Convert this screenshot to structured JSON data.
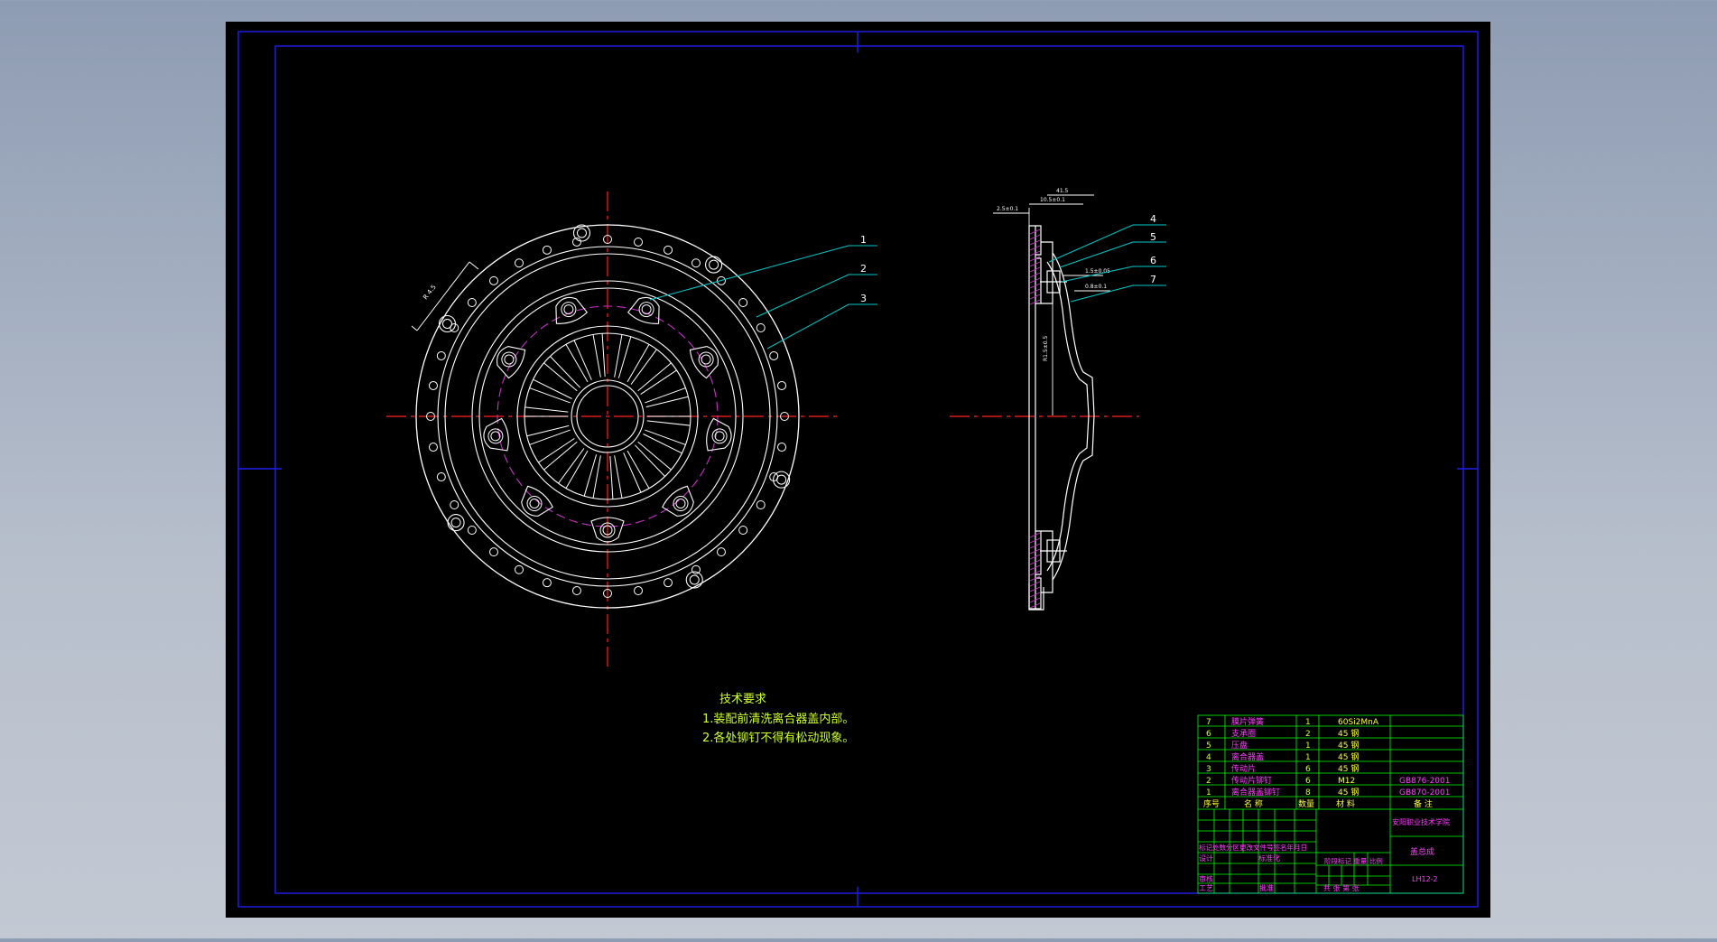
{
  "colors": {
    "background": "#000000",
    "frame": "#1e1ef0",
    "geometry": "#ffffff",
    "leader": "#00c8c8",
    "centerline": "#ff2020",
    "hidden": "#c832c8",
    "table_line": "#00ff00",
    "text_green": "#d0ff30",
    "text_magenta": "#ff40ff",
    "text_yellow": "#ffff40"
  },
  "balloons": [
    "1",
    "2",
    "3",
    "4",
    "5",
    "6",
    "7"
  ],
  "notes": {
    "title": "技术要求",
    "items": [
      "1.装配前清洗离合器盖内部。",
      "2.各处铆钉不得有松动现象。"
    ]
  },
  "bom": {
    "rows": [
      {
        "no": "7",
        "name": "膜片弹簧",
        "qty": "1",
        "material": "60Si2MnA",
        "remark": ""
      },
      {
        "no": "6",
        "name": "支承圈",
        "qty": "2",
        "material": "45 钢",
        "remark": ""
      },
      {
        "no": "5",
        "name": "压盘",
        "qty": "1",
        "material": "45 钢",
        "remark": ""
      },
      {
        "no": "4",
        "name": "离合器盖",
        "qty": "1",
        "material": "45 钢",
        "remark": ""
      },
      {
        "no": "3",
        "name": "传动片",
        "qty": "6",
        "material": "45 钢",
        "remark": ""
      },
      {
        "no": "2",
        "name": "传动片铆钉",
        "qty": "6",
        "material": "M12",
        "remark": "GB876-2001"
      },
      {
        "no": "1",
        "name": "离合器盖铆钉",
        "qty": "8",
        "material": "45 钢",
        "remark": "GB870-2001"
      }
    ],
    "header": {
      "no": "序号",
      "name": "名 称",
      "qty": "数量",
      "material": "材 料",
      "remark": "备 注"
    }
  },
  "title_block": {
    "school": "安阳职业技术学院",
    "part_name": "盖总成",
    "drawing_no": "LH12-2",
    "sign_row": "标记处数分区更改文件号签名年月日",
    "design": "设计",
    "standard": "标准化",
    "review": "审核",
    "process": "工艺",
    "approve": "批准",
    "stage_row": "阶段标记 重量 比例",
    "sheet_row": "共 张 第 张"
  }
}
